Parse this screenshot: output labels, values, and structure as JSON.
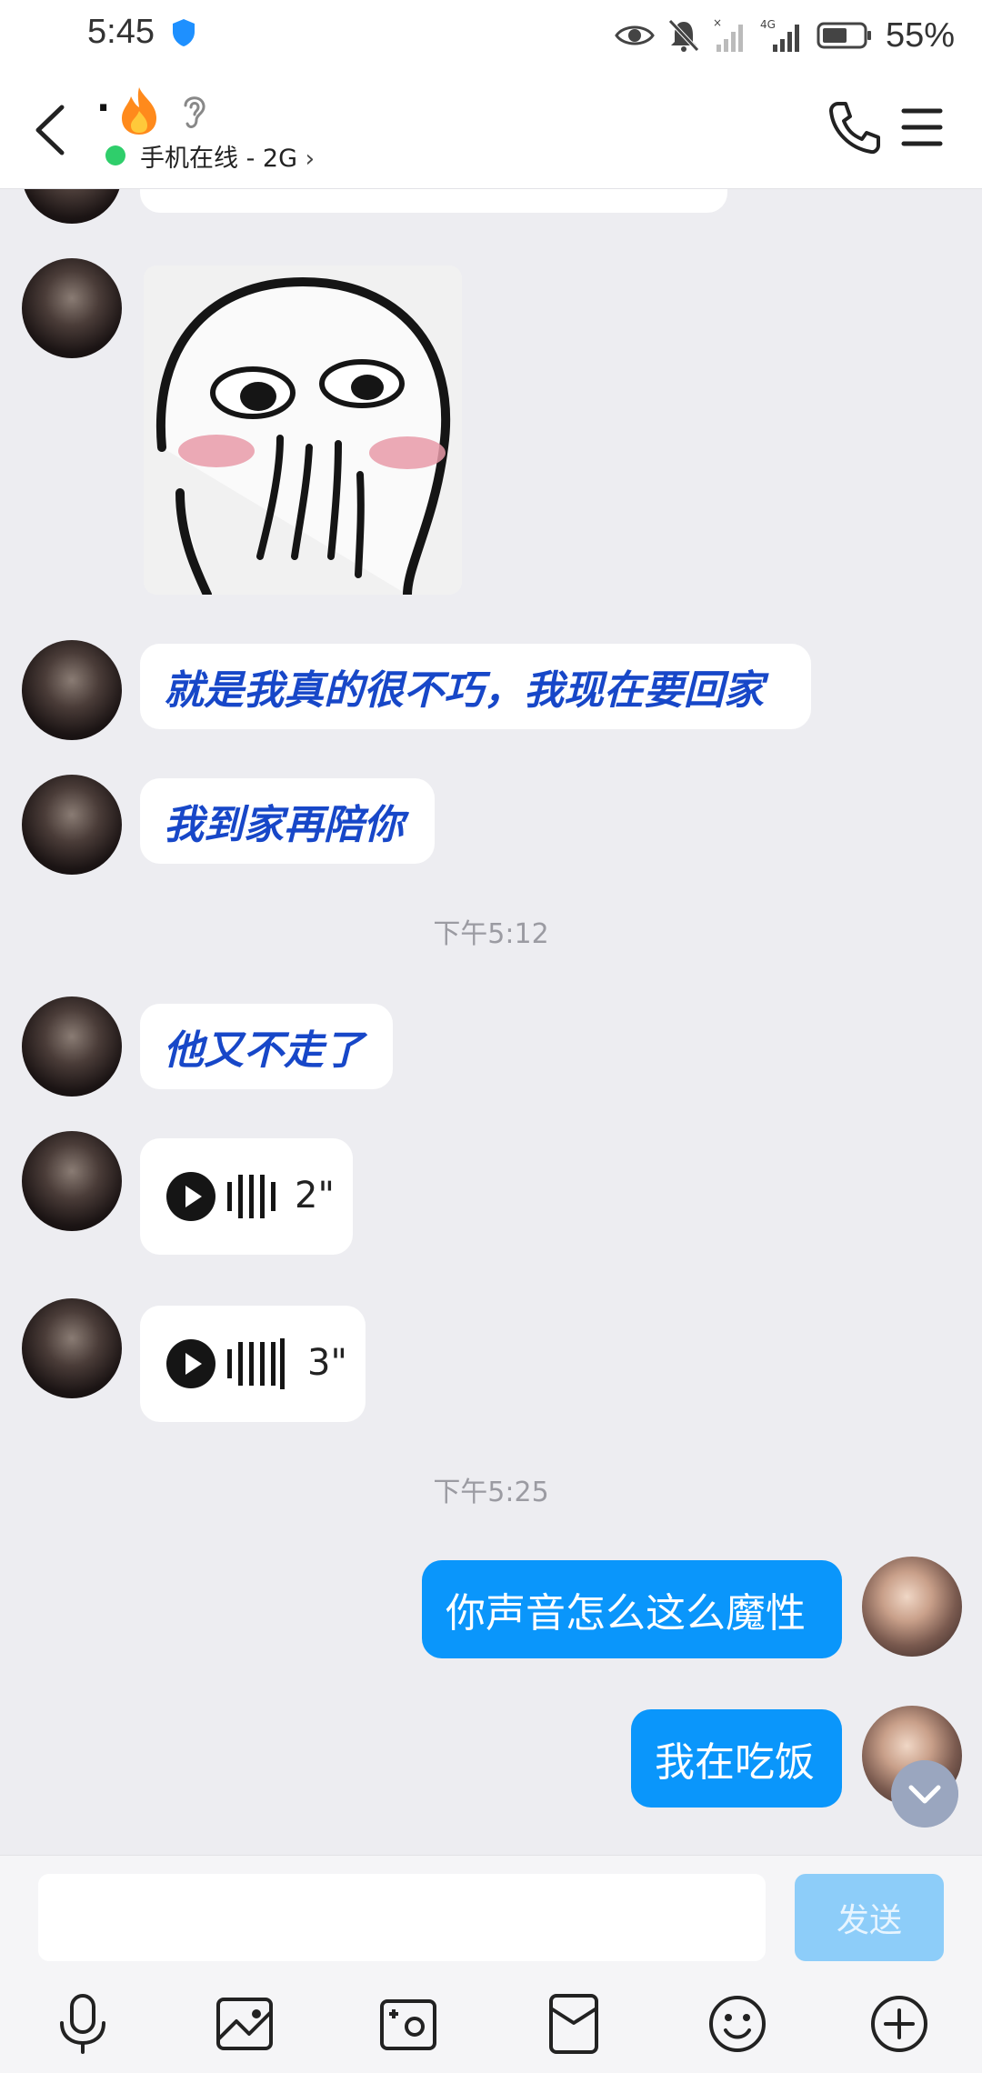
{
  "status_bar": {
    "time": "5:45",
    "battery": "55%",
    "icons": [
      "shield-icon",
      "eye-icon",
      "mute-bell-icon",
      "signal-icon",
      "4g-signal-icon",
      "battery-icon"
    ]
  },
  "header": {
    "contact_name": ".",
    "status": "手机在线 - 2G",
    "icons": [
      "back-arrow-icon",
      "fire-icon",
      "ear-icon",
      "phone-icon",
      "menu-icon"
    ]
  },
  "messages": [
    {
      "sender": "other",
      "type": "sticker"
    },
    {
      "sender": "other",
      "type": "text",
      "text": "就是我真的很不巧，我现在要回家"
    },
    {
      "sender": "other",
      "type": "text",
      "text": "我到家再陪你"
    },
    {
      "type": "timestamp",
      "text": "下午5:12"
    },
    {
      "sender": "other",
      "type": "text",
      "text": "他又不走了"
    },
    {
      "sender": "other",
      "type": "voice",
      "duration": "2\""
    },
    {
      "sender": "other",
      "type": "voice",
      "duration": "3\""
    },
    {
      "type": "timestamp",
      "text": "下午5:25"
    },
    {
      "sender": "me",
      "type": "text",
      "text": "你声音怎么这么魔性"
    },
    {
      "sender": "me",
      "type": "text",
      "text": "我在吃饭"
    }
  ],
  "input": {
    "value": "",
    "send_label": "发送"
  },
  "toolbar": [
    "microphone-icon",
    "image-icon",
    "camera-icon",
    "red-packet-icon",
    "emoji-icon",
    "plus-icon"
  ],
  "colors": {
    "accent_blue": "#0a96fb",
    "other_text_blue": "#1747c8",
    "online_green": "#2fce6b",
    "chat_bg": "#ededf1"
  }
}
